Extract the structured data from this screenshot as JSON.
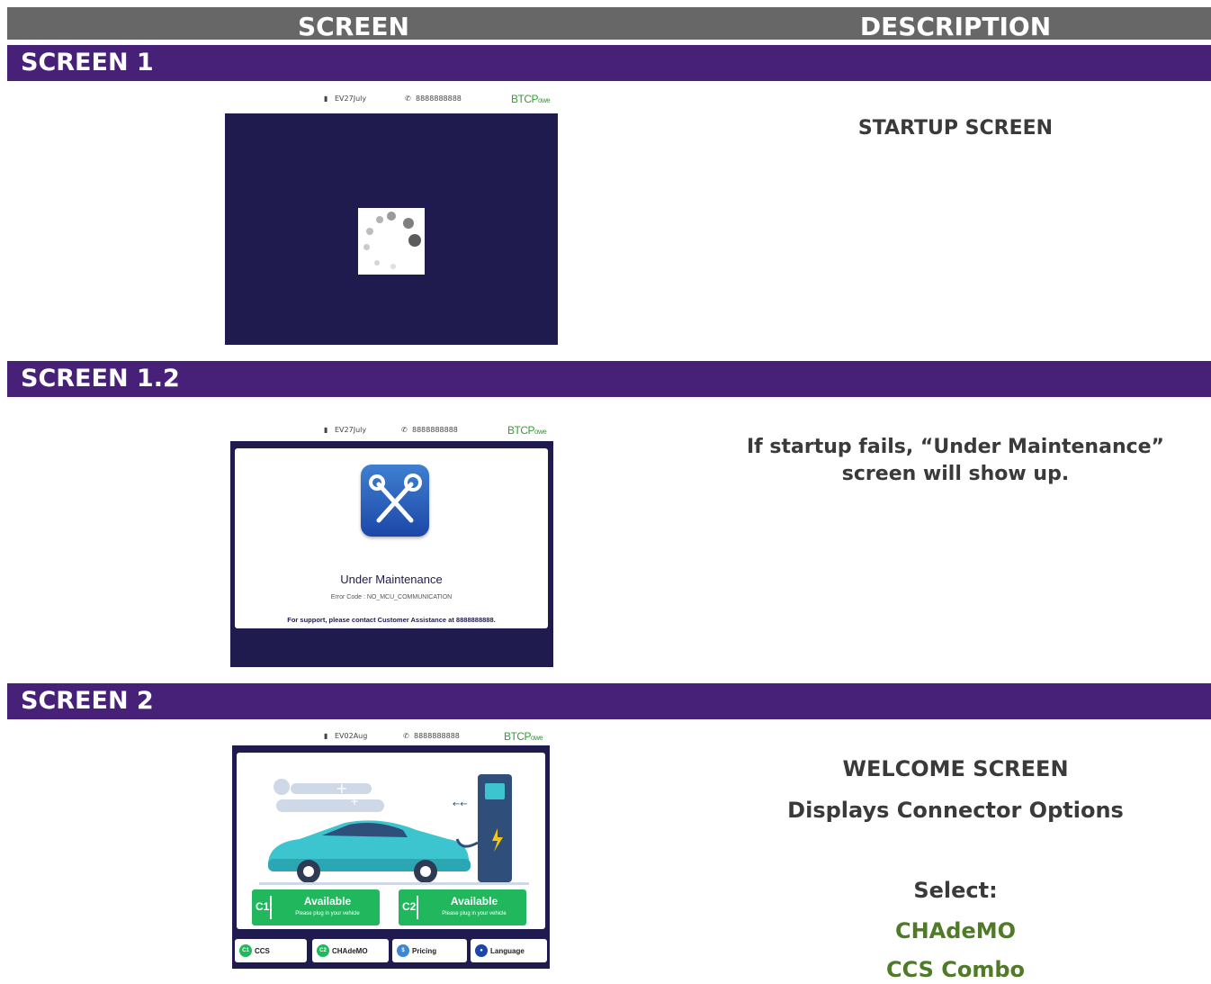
{
  "header": {
    "col_screen": "SCREEN",
    "col_description": "DESCRIPTION"
  },
  "sections": [
    {
      "title": "SCREEN 1",
      "mock": {
        "device": "EV27July",
        "phone": "8888888888",
        "brand_main": "BTCP",
        "brand_sub": "owe"
      },
      "description": [
        "STARTUP SCREEN"
      ]
    },
    {
      "title": "SCREEN 1.2",
      "mock": {
        "device": "EV27July",
        "phone": "8888888888",
        "brand_main": "BTCP",
        "brand_sub": "owe",
        "title": "Under Maintenance",
        "error": "Error Code : NO_MCU_COMMUNICATION",
        "support": "For support, please contact Customer Assistance at 8888888888."
      },
      "description": [
        "If startup fails, “Under Maintenance”",
        "screen will show up."
      ]
    },
    {
      "title": "SCREEN 2",
      "mock": {
        "device": "EV02Aug",
        "phone": "8888888888",
        "brand_main": "BTCP",
        "brand_sub": "owe",
        "connectors": [
          {
            "id": "C1",
            "status": "Available",
            "hint": "Please plug in your vehicle"
          },
          {
            "id": "C2",
            "status": "Available",
            "hint": "Please plug in your vehicle"
          }
        ],
        "buttons": [
          {
            "icon": "C1",
            "label": "CCS"
          },
          {
            "icon": "C2",
            "label": "CHAdeMO"
          },
          {
            "icon": "$",
            "label": "Pricing"
          },
          {
            "icon": "globe",
            "label": "Language"
          }
        ],
        "colors": {
          "available": "#21b85d",
          "navy": "#1f1b4f"
        }
      },
      "description": [
        "WELCOME SCREEN",
        "Displays Connector Options",
        "Select:",
        "CHAdeMO",
        "CCS Combo"
      ]
    }
  ],
  "colors": {
    "header_bg": "#676767",
    "section_bar": "#472178",
    "option_green": "#4f7a28"
  }
}
